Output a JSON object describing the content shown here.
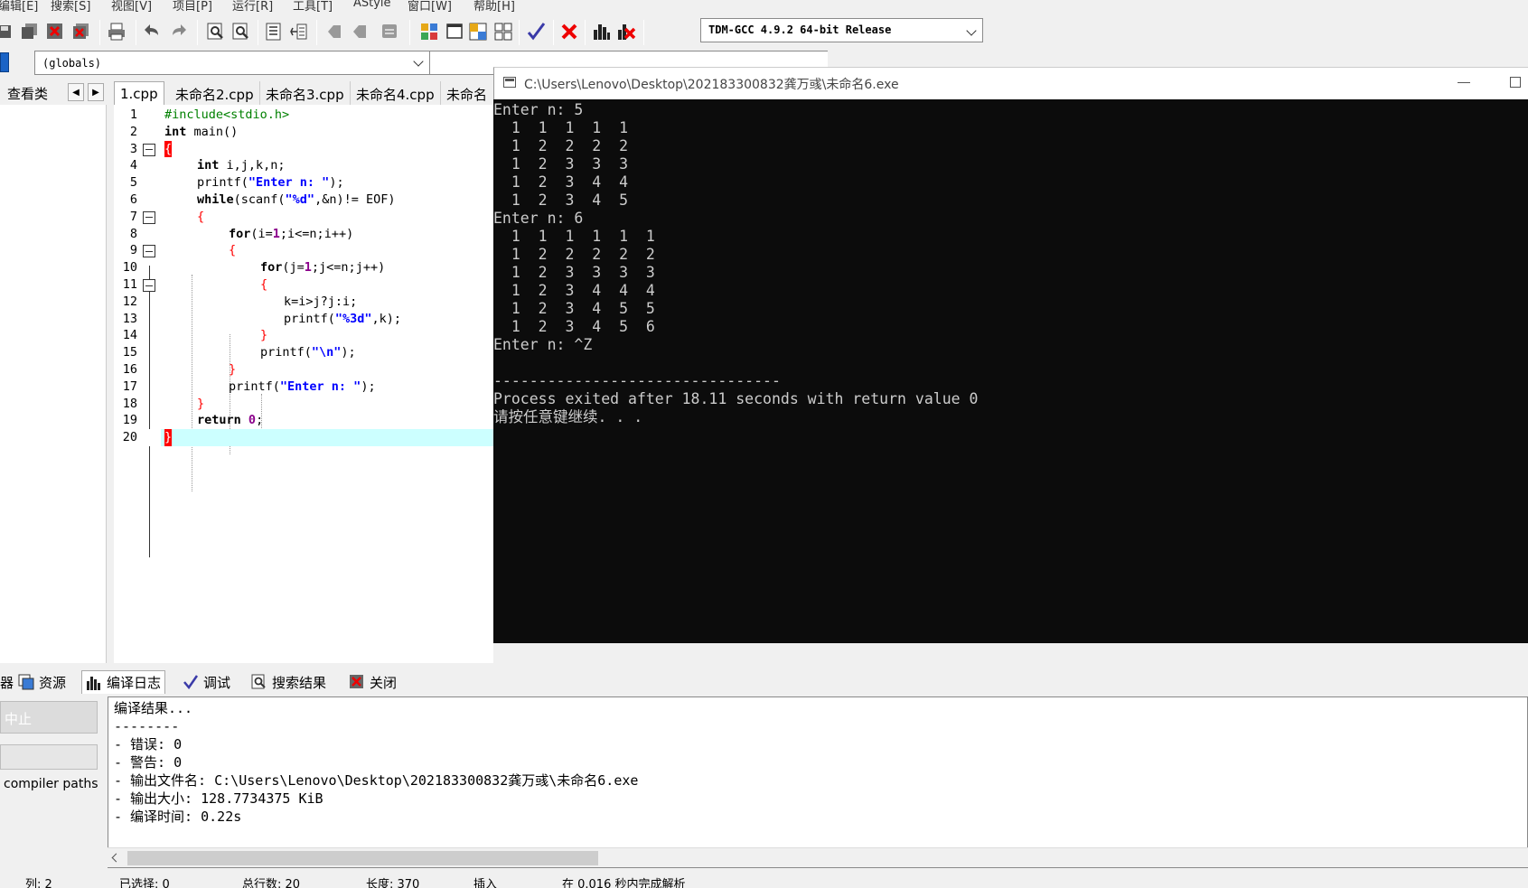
{
  "menu": {
    "items": [
      "编辑[E]",
      "搜索[S]",
      "视图[V]",
      "项目[P]",
      "运行[R]",
      "工具[T]",
      "AStyle",
      "窗口[W]",
      "帮助[H]"
    ]
  },
  "toolbar": {
    "compiler": "TDM-GCC 4.9.2 64-bit Release"
  },
  "scope": {
    "value": "(globals)"
  },
  "tabs": {
    "class_tab": "查看类",
    "files": [
      "1.cpp",
      "未命名2.cpp",
      "未命名3.cpp",
      "未命名4.cpp",
      "未命名"
    ]
  },
  "editor": {
    "line_numbers": [
      "1",
      "2",
      "3",
      "4",
      "5",
      "6",
      "7",
      "8",
      "9",
      "10",
      "11",
      "12",
      "13",
      "14",
      "15",
      "16",
      "17",
      "18",
      "19",
      "20"
    ],
    "code": {
      "l1": "#include<stdio.h>",
      "l2_kw": "int",
      "l2_rest": " main()",
      "l3": "{",
      "l4_kw": "int",
      "l4_rest": " i,j,k,n;",
      "l5_a": "printf(",
      "l5_str": "\"Enter n: \"",
      "l5_b": ");",
      "l6_kw": "while",
      "l6_a": "(scanf(",
      "l6_str": "\"%d\"",
      "l6_b": ",&n)!= EOF)",
      "l7": "{",
      "l8_kw": "for",
      "l8_a": "(i=",
      "l8_n1": "1",
      "l8_b": ";i<=n;i++)",
      "l9": "{",
      "l10_kw": "for",
      "l10_a": "(j=",
      "l10_n1": "1",
      "l10_b": ";j<=n;j++)",
      "l11": "{",
      "l12": "k=i>j?j:i;",
      "l13_a": "printf(",
      "l13_str": "\"%3d\"",
      "l13_b": ",k);",
      "l14": "}",
      "l15_a": "printf(",
      "l15_str": "\"\\n\"",
      "l15_b": ");",
      "l16": "}",
      "l17_a": "printf(",
      "l17_str": "\"Enter n: \"",
      "l17_b": ");",
      "l18": "}",
      "l19_kw": "return",
      "l19_n": "0",
      "l19_b": ";",
      "l20": "}"
    }
  },
  "console": {
    "title": "C:\\Users\\Lenovo\\Desktop\\202183300832龚万彧\\未命名6.exe",
    "lines": [
      "Enter n: 5",
      "  1  1  1  1  1",
      "  1  2  2  2  2",
      "  1  2  3  3  3",
      "  1  2  3  4  4",
      "  1  2  3  4  5",
      "Enter n: 6",
      "  1  1  1  1  1  1",
      "  1  2  2  2  2  2",
      "  1  2  3  3  3  3",
      "  1  2  3  4  4  4",
      "  1  2  3  4  5  5",
      "  1  2  3  4  5  6",
      "Enter n: ^Z",
      "",
      "--------------------------------",
      "Process exited after 18.11 seconds with return value 0",
      "请按任意键继续. . ."
    ]
  },
  "bottom": {
    "tabs": [
      "器",
      "资源",
      "编译日志",
      "调试",
      "搜索结果",
      "关闭"
    ],
    "stop_button": "中止",
    "compiler_paths": "compiler paths",
    "log": [
      "编译结果...",
      "--------",
      "- 错误: 0",
      "- 警告: 0",
      "- 输出文件名: C:\\Users\\Lenovo\\Desktop\\202183300832龚万彧\\未命名6.exe",
      "- 输出大小: 128.7734375 KiB",
      "- 编译时间: 0.22s"
    ]
  },
  "status": {
    "col": "列:   2",
    "selected": "已选择:   0",
    "total_lines": "总行数:   20",
    "length": "长度:   370",
    "mode": "插入",
    "parse": "在 0.016 秒内完成解析"
  },
  "colors": {
    "console_bg": "#0c0c0c",
    "console_fg": "#cccccc",
    "string": "#0000ff",
    "number": "#8b008b",
    "preprocessor": "#008000",
    "brace_match": "#ff0000",
    "current_line": "#ccffff"
  }
}
